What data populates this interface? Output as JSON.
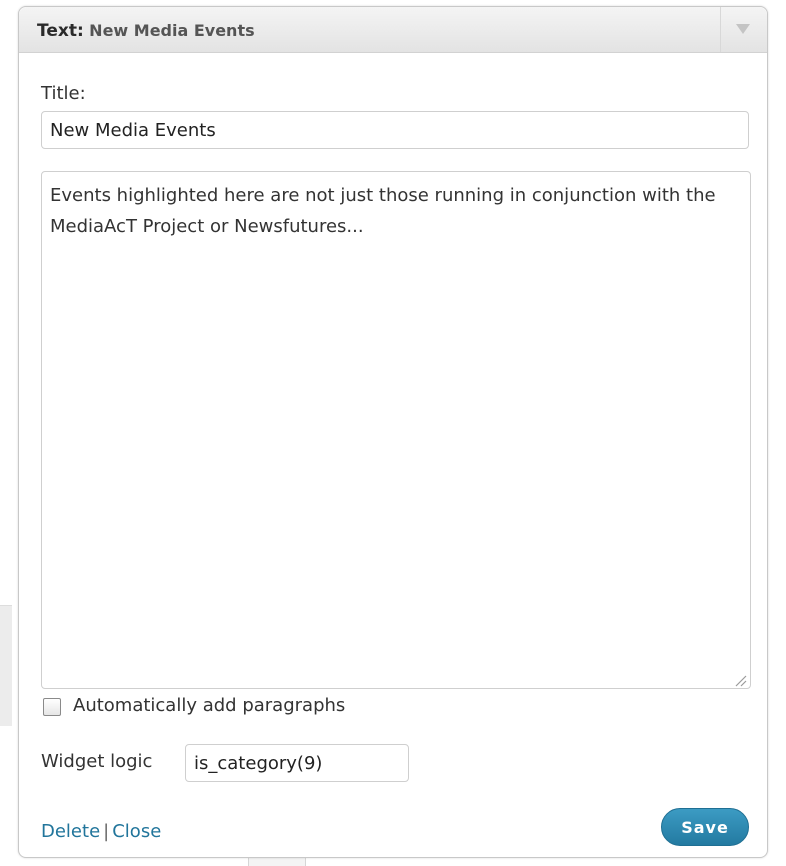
{
  "widget": {
    "type_label": "Text:",
    "name": "New Media Events"
  },
  "form": {
    "title_label": "Title:",
    "title_value": "New Media Events",
    "content_text": "Events highlighted here are not just those running in conjunction with the MediaAcT Project or Newsfutures...",
    "auto_paragraphs_label": "Automatically add paragraphs",
    "auto_paragraphs_checked": false,
    "widget_logic_label": "Widget logic",
    "widget_logic_value": "is_category(9)"
  },
  "footer": {
    "delete_label": "Delete",
    "separator": "|",
    "close_label": "Close",
    "save_label": "Save"
  },
  "colors": {
    "link": "#21759b",
    "save_button": "#237aa1",
    "header_background": "#e3e3e3"
  },
  "icons": {
    "toggle": "triangle-down-icon",
    "resize": "resize-grip-icon"
  }
}
